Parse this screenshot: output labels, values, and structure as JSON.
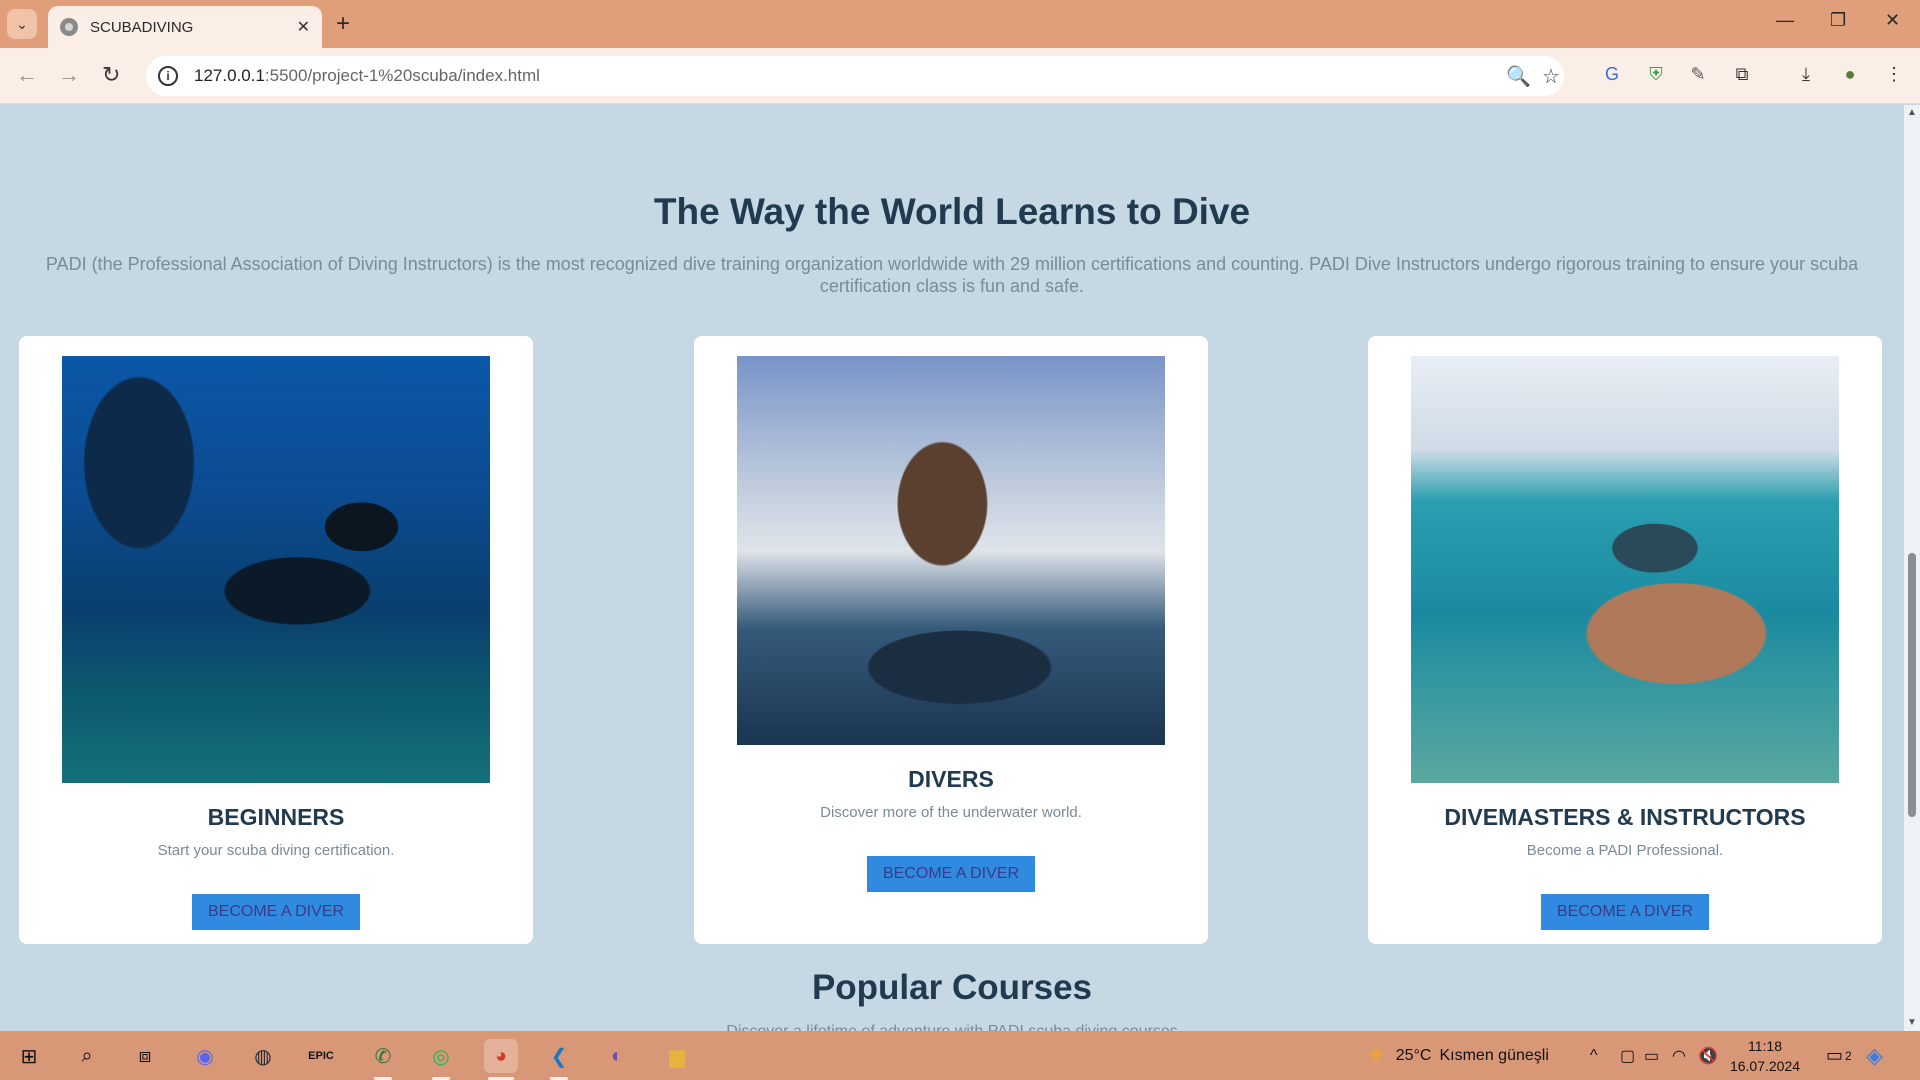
{
  "browser": {
    "tab_title": "SCUBADIVING",
    "url_host": "127.0.0.1",
    "url_rest": ":5500/project-1%20scuba/index.html"
  },
  "hero": {
    "title": "The Way the World Learns to Dive",
    "text": "PADI (the Professional Association of Diving Instructors) is the most recognized dive training organization worldwide with 29 million certifications and counting. PADI Dive Instructors undergo rigorous training to ensure your scuba certification class is fun and safe."
  },
  "cards": [
    {
      "title": "BEGINNERS",
      "text": "Start your scuba diving certification.",
      "button": "BECOME A DIVER"
    },
    {
      "title": "DIVERS",
      "text": "Discover more of the underwater world.",
      "button": "BECOME A DIVER"
    },
    {
      "title": "DIVEMASTERS & INSTRUCTORS",
      "text": "Become a PADI Professional.",
      "button": "BECOME A DIVER"
    }
  ],
  "popular": {
    "title": "Popular Courses",
    "subtitle": "Discover a lifetime of adventure with PADI scuba diving courses"
  },
  "taskbar": {
    "weather_temp": "25°C",
    "weather_text": "Kısmen güneşli",
    "time": "11:18",
    "date": "16.07.2024",
    "notifications": "2"
  },
  "colors": {
    "page_bg": "#c5d8e4",
    "heading": "#223a50",
    "button_bg": "#2f8ae0",
    "chrome": "#e19e7b"
  }
}
